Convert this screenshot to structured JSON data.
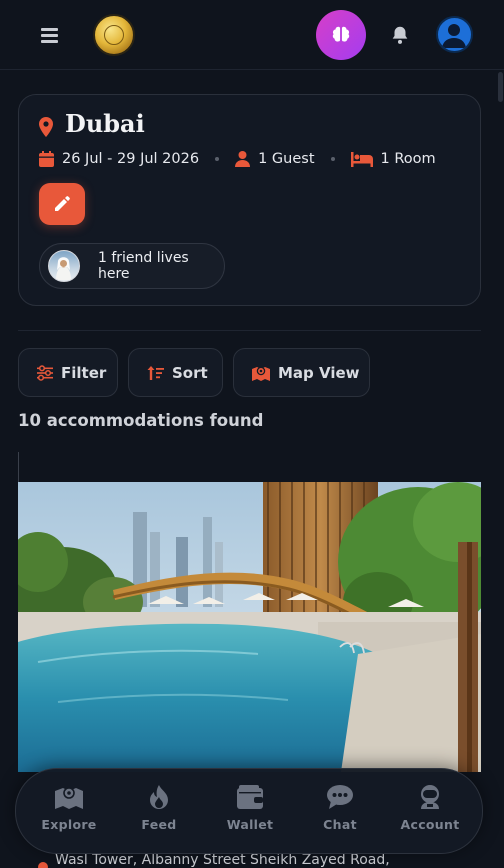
{
  "header": {
    "menu_icon": "hamburger-icon",
    "logo_icon": "gold-coin-logo",
    "ai_icon": "brain-icon",
    "notification_icon": "bell-icon",
    "profile_icon": "user-avatar-icon"
  },
  "search": {
    "city": "Dubai",
    "dates": "26 Jul - 29 Jul 2026",
    "guests": "1 Guest",
    "rooms": "1 Room",
    "edit_icon": "pencil-icon",
    "friends_text": "1 friend lives here"
  },
  "toolbar": {
    "filter_label": "Filter",
    "sort_label": "Sort",
    "map_label": "Map View"
  },
  "results": {
    "count_text": "10 accommodations found",
    "first_address": "Wasl Tower, Albanny Street Sheikh Zayed Road,"
  },
  "nav": [
    {
      "label": "Explore",
      "icon": "map-icon"
    },
    {
      "label": "Feed",
      "icon": "fire-icon"
    },
    {
      "label": "Wallet",
      "icon": "wallet-icon"
    },
    {
      "label": "Chat",
      "icon": "chat-icon"
    },
    {
      "label": "Account",
      "icon": "astronaut-icon"
    }
  ],
  "colors": {
    "accent": "#e8583a",
    "ai_gradient_start": "#d63ec8",
    "ai_gradient_end": "#a43df0",
    "background": "#0f141d"
  }
}
